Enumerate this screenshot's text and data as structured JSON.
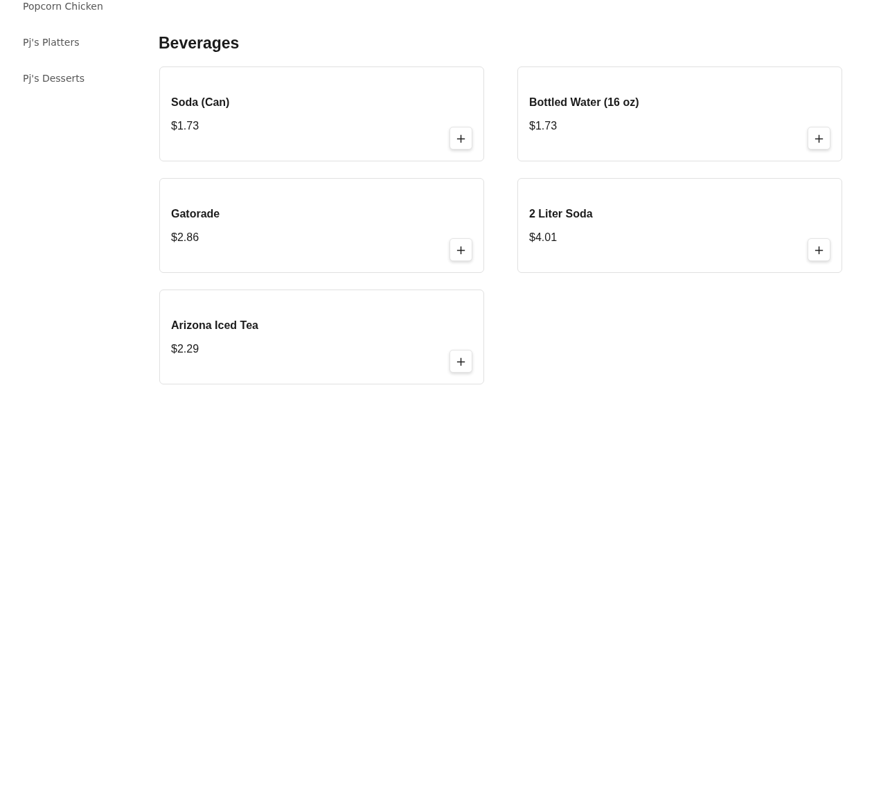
{
  "sidebar": {
    "items": [
      {
        "label": "Popcorn Chicken"
      },
      {
        "label": "Pj's Platters"
      },
      {
        "label": "Pj's Desserts"
      }
    ]
  },
  "section": {
    "title": "Beverages",
    "items": [
      {
        "name": "Soda (Can)",
        "price": "$1.73",
        "button": "+"
      },
      {
        "name": "Bottled Water (16 oz)",
        "price": "$1.73",
        "button": "+"
      },
      {
        "name": "Gatorade",
        "price": "$2.86",
        "button": "+"
      },
      {
        "name": "2 Liter Soda",
        "price": "$4.01",
        "button": "+"
      },
      {
        "name": "Arizona Iced Tea",
        "price": "$2.29",
        "button": "+"
      }
    ]
  }
}
